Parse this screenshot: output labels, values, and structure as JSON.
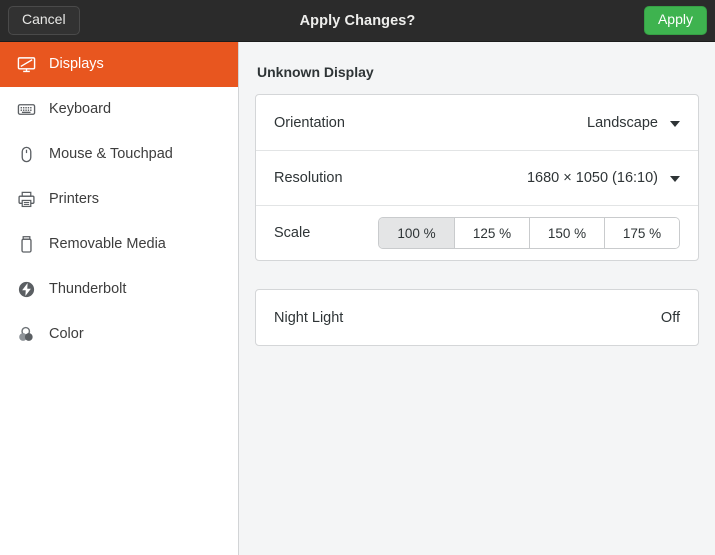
{
  "header": {
    "title": "Apply Changes?",
    "cancel_label": "Cancel",
    "apply_label": "Apply",
    "background_color": "#2b2b2b",
    "apply_color": "#3eb34f"
  },
  "sidebar": {
    "accent_color": "#e8561f",
    "items": [
      {
        "label": "Displays",
        "icon": "display-icon",
        "selected": true
      },
      {
        "label": "Keyboard",
        "icon": "keyboard-icon",
        "selected": false
      },
      {
        "label": "Mouse & Touchpad",
        "icon": "mouse-icon",
        "selected": false
      },
      {
        "label": "Printers",
        "icon": "printer-icon",
        "selected": false
      },
      {
        "label": "Removable Media",
        "icon": "usb-drive-icon",
        "selected": false
      },
      {
        "label": "Thunderbolt",
        "icon": "thunderbolt-icon",
        "selected": false
      },
      {
        "label": "Color",
        "icon": "color-icon",
        "selected": false
      }
    ]
  },
  "content": {
    "panel_title": "Unknown Display",
    "display_card": {
      "orientation": {
        "label": "Orientation",
        "value": "Landscape"
      },
      "resolution": {
        "label": "Resolution",
        "value": "1680 × 1050 (16:10)"
      },
      "scale": {
        "label": "Scale",
        "options": [
          "100 %",
          "125 %",
          "150 %",
          "175 %"
        ],
        "selected_index": 0
      }
    },
    "night_light": {
      "label": "Night Light",
      "value": "Off"
    }
  }
}
